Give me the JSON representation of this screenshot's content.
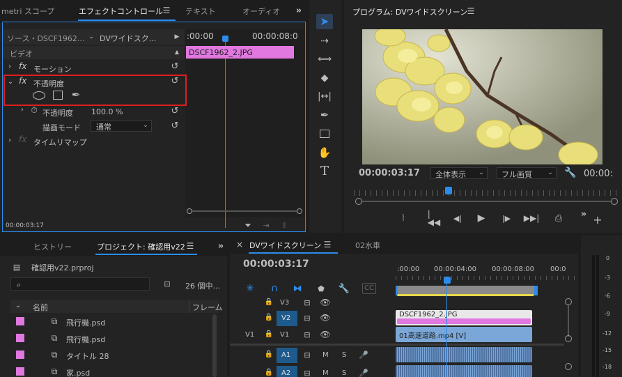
{
  "effect_panel": {
    "tabs": [
      "metri スコープ",
      "エフェクトコントロール",
      "テキスト",
      "オーディオ"
    ],
    "source_label": "ソース・DSCF1962...",
    "sequence_label": "DVワイドスク...",
    "timecodes": [
      ":00:00",
      "00:00:08:0"
    ],
    "clip_label": "DSCF1962_2.JPG",
    "video_header": "ビデオ",
    "motion": "モーション",
    "opacity": "不透明度",
    "opacity_param": "不透明度",
    "opacity_value": "100.0 %",
    "blend_mode_label": "描画モード",
    "blend_mode_value": "通常",
    "time_remap": "タイムリマップ",
    "footer_time": "00:00:03:17",
    "fx": "fx"
  },
  "tools": [
    "selection-tool",
    "track-select-tool",
    "ripple-edit-tool",
    "razor-tool",
    "slip-tool",
    "pen-tool",
    "rectangle-tool",
    "hand-tool",
    "type-tool"
  ],
  "program_monitor": {
    "title": "プログラム: DVワイドスクリーン",
    "timecode": "00:00:03:17",
    "zoom": "全体表示",
    "quality": "フル画質",
    "end_time": "00:00:"
  },
  "project_panel": {
    "tabs": [
      "ヒストリー",
      "プロジェクト: 確認用v22"
    ],
    "file": "確認用v22.prproj",
    "item_count": "26 個中...",
    "col_name": "名前",
    "col_frame": "フレーム",
    "items": [
      "飛行機.psd",
      "飛行機.psd",
      "タイトル 28",
      "家.psd"
    ],
    "item_color": "#e078e0"
  },
  "timeline": {
    "tabs": [
      "DVワイドスクリーン",
      "02水車"
    ],
    "close": "×",
    "timecode": "00:00:03:17",
    "ruler": [
      ":00:00",
      "00:00:04:00",
      "00:00:08:00",
      "00:0"
    ],
    "tracks": [
      {
        "name": "V3",
        "src": ""
      },
      {
        "name": "V2",
        "src": ""
      },
      {
        "name": "V1",
        "src": "V1"
      },
      {
        "name": "A1",
        "src": "",
        "m": "M",
        "s": "S"
      },
      {
        "name": "A2",
        "src": "",
        "m": "M",
        "s": "S"
      }
    ],
    "clip_v2": "DSCF1962_2.JPG",
    "clip_v1": "01高速道路.mp4 [V]",
    "clip_v2_color": "#e078e0",
    "clip_v1_color": "#7ba7d8"
  },
  "audio_meter": {
    "levels": [
      "0",
      "-3",
      "-6",
      "-9",
      "-12",
      "-15",
      "-18"
    ]
  }
}
